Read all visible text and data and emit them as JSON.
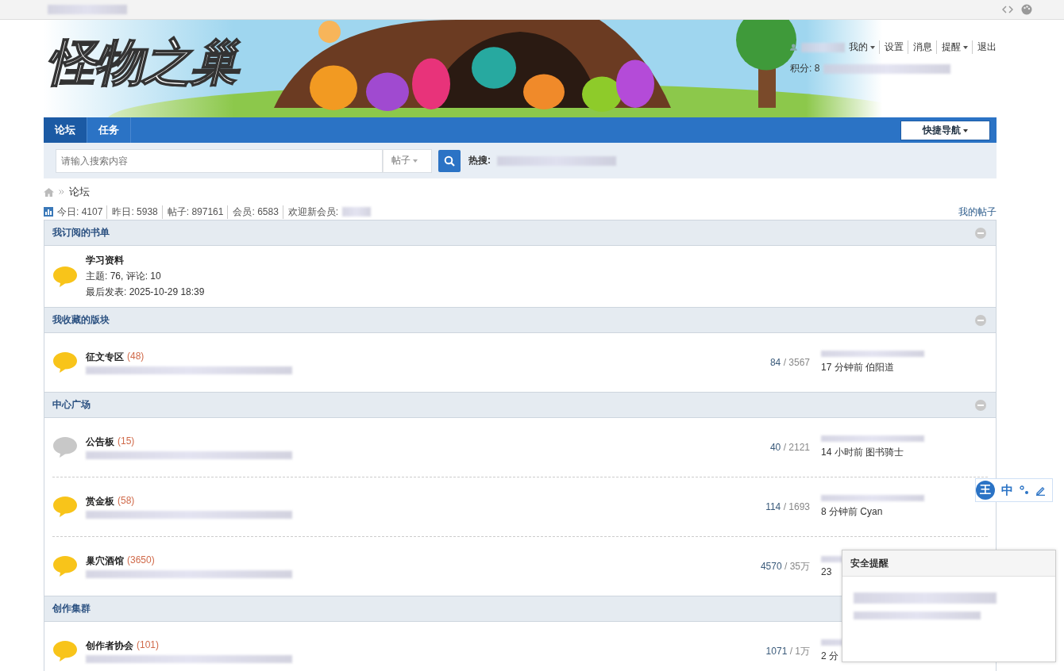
{
  "logo": "怪物之巢",
  "user_menu": [
    {
      "label": "我的",
      "dropdown": true
    },
    {
      "label": "设置",
      "dropdown": false
    },
    {
      "label": "消息",
      "dropdown": false
    },
    {
      "label": "提醒",
      "dropdown": true
    },
    {
      "label": "退出",
      "dropdown": false
    }
  ],
  "credits_label": "积分: 8",
  "nav": {
    "tabs": [
      {
        "label": "论坛",
        "selected": true
      },
      {
        "label": "任务",
        "selected": false
      }
    ],
    "quick_nav": "快捷导航"
  },
  "search": {
    "placeholder": "请输入搜索内容",
    "type": "帖子",
    "hot_label": "热搜:"
  },
  "breadcrumb": [
    "论坛"
  ],
  "stats": [
    "今日: 4107",
    "昨日: 5938",
    "帖子: 897161",
    "会员: 6583",
    "欢迎新会员:"
  ],
  "my_posts": "我的帖子",
  "sections": [
    {
      "title": "我订阅的书单",
      "collapsible": true,
      "forums": [
        {
          "name": "学习资料",
          "new": true,
          "lines": [
            "主题: 76, 评论: 10",
            "最后发表: 2025-10-29 18:39"
          ]
        }
      ]
    },
    {
      "title": "我收藏的版块",
      "collapsible": true,
      "forums": [
        {
          "name": "征文专区",
          "count": "(48)",
          "new": true,
          "threads": "84",
          "posts": "/ 3567",
          "last": "17 分钟前 伯阳道"
        }
      ]
    },
    {
      "title": "中心广场",
      "collapsible": true,
      "forums": [
        {
          "name": "公告板",
          "count": "(15)",
          "new": false,
          "threads": "40",
          "posts": "/ 2121",
          "last": "14 小时前 图书骑士"
        },
        {
          "name": "赏金板",
          "count": "(58)",
          "new": true,
          "threads": "114",
          "posts": "/ 1693",
          "last": "8 分钟前 Cyan"
        },
        {
          "name": "巢穴酒馆",
          "count": "(3650)",
          "new": true,
          "threads": "4570",
          "posts": "/ 35万",
          "last": "23"
        }
      ]
    },
    {
      "title": "创作集群",
      "collapsible": false,
      "forums": [
        {
          "name": "创作者协会",
          "count": "(101)",
          "new": true,
          "threads": "1071",
          "posts": "/ 1万",
          "last": "2 分"
        }
      ]
    }
  ],
  "ime": [
    "王",
    "中"
  ],
  "popup": {
    "title": "安全提醒"
  }
}
